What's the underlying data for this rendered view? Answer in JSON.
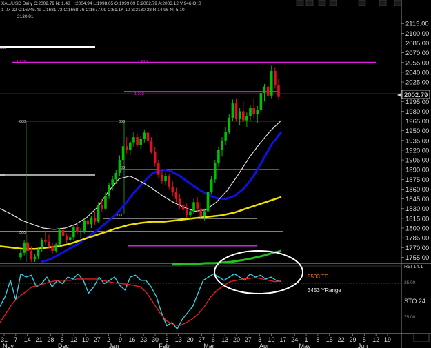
{
  "header": {
    "line1": "XAU/USD Daily C:2002.79 N: 1.48 H:2004.94 L:1998.05 O:1999.09 B:2002.79 A:2003.12 V:946 OI:0",
    "line2": "1-07-22 C:16745.49 L:1681.72 C:1668.76 C:1677.09 C:61.1K 10 S:2130.38 R:14.96 N:-5.10",
    "line3": "2130.91"
  },
  "price_axis": {
    "ticks": [
      2115,
      2100,
      2085,
      2070,
      2055,
      2040,
      2025,
      2010,
      1995,
      1980,
      1965,
      1950,
      1935,
      1920,
      1905,
      1890,
      1875,
      1860,
      1845,
      1830,
      1815,
      1800,
      1785,
      1770,
      1755
    ],
    "tick_labels": [
      "2115.00",
      "2100.00",
      "2085.00",
      "2070.00",
      "2055.00",
      "2040.00",
      "2025.00",
      "2010.00",
      "1995.00",
      "1980.00",
      "1965.00",
      "1950.00",
      "1935.00",
      "1920.00",
      "1905.00",
      "1890.00",
      "1875.00",
      "1860.00",
      "1845.00",
      "1830.00",
      "1815.00",
      "1800.00",
      "1785.00",
      "1770.00",
      "1755.00"
    ],
    "last_price_label": "2002.79"
  },
  "fib_labels": {
    "top_left": "1.272",
    "top_mid": "1.618",
    "upper": "1.272",
    "mid_left": "000",
    "mid_mid": "000",
    "half_left": "500",
    "half_mid": "500",
    "low_mid": "1.000",
    "low_left": "500",
    "far_left_top": "000",
    "far_left_mid": "000"
  },
  "osc_labels": {
    "td": "5503 TD",
    "yrange": "3453 YRange",
    "level25": "25.00",
    "level75": "75.00",
    "sto": "STO  24",
    "rsi": "RSI 14.1"
  },
  "x_axis": {
    "day_labels": [
      "31",
      "7",
      "14",
      "21",
      "28",
      "5",
      "12",
      "19",
      "27",
      "2",
      "9",
      "16",
      "23",
      "30",
      "6",
      "13",
      "20",
      "27",
      "6",
      "13",
      "20",
      "27",
      "3",
      "10",
      "17",
      "24",
      "1",
      "8",
      "15",
      "22",
      "29",
      "5",
      "12",
      "19"
    ],
    "month_labels": [
      "Nov",
      "Dec",
      "Jan",
      "Feb",
      "Mar",
      "Apr",
      "May",
      "Jun"
    ]
  },
  "colors": {
    "background": "#000000",
    "bull_candle": "#00c000",
    "bear_candle": "#e01020",
    "fib_magenta": "#e020e0",
    "ma_blue": "#1010e0",
    "ma_white": "#e0e0e0",
    "ma_yellow": "#f0e000",
    "ma_green": "#20c020",
    "osc_cyan": "#30d0e0",
    "osc_red": "#e02020",
    "ellipse": "#ffffff"
  },
  "chart_data": {
    "type": "candlestick",
    "instrument": "XAU/USD",
    "timeframe": "Daily",
    "ylim": [
      1748,
      2128
    ],
    "candles_ohlc": [
      [
        1755,
        1768,
        1750,
        1762
      ],
      [
        1762,
        1782,
        1758,
        1778
      ],
      [
        1778,
        1790,
        1760,
        1765
      ],
      [
        1765,
        1772,
        1748,
        1752
      ],
      [
        1752,
        1760,
        1748,
        1756
      ],
      [
        1756,
        1770,
        1752,
        1768
      ],
      [
        1768,
        1785,
        1764,
        1782
      ],
      [
        1782,
        1795,
        1775,
        1779
      ],
      [
        1779,
        1790,
        1768,
        1772
      ],
      [
        1772,
        1778,
        1760,
        1765
      ],
      [
        1765,
        1778,
        1762,
        1775
      ],
      [
        1775,
        1800,
        1772,
        1797
      ],
      [
        1797,
        1802,
        1785,
        1788
      ],
      [
        1788,
        1792,
        1778,
        1781
      ],
      [
        1781,
        1790,
        1772,
        1786
      ],
      [
        1786,
        1805,
        1782,
        1802
      ],
      [
        1802,
        1808,
        1790,
        1794
      ],
      [
        1794,
        1800,
        1785,
        1796
      ],
      [
        1796,
        1815,
        1792,
        1812
      ],
      [
        1812,
        1820,
        1800,
        1806
      ],
      [
        1806,
        1818,
        1800,
        1815
      ],
      [
        1815,
        1825,
        1805,
        1810
      ],
      [
        1810,
        1840,
        1808,
        1836
      ],
      [
        1836,
        1845,
        1825,
        1830
      ],
      [
        1830,
        1855,
        1828,
        1850
      ],
      [
        1850,
        1870,
        1845,
        1866
      ],
      [
        1866,
        1880,
        1858,
        1875
      ],
      [
        1875,
        1890,
        1868,
        1885
      ],
      [
        1885,
        1912,
        1880,
        1905
      ],
      [
        1905,
        1930,
        1900,
        1926
      ],
      [
        1926,
        1940,
        1915,
        1920
      ],
      [
        1920,
        1935,
        1912,
        1932
      ],
      [
        1932,
        1948,
        1925,
        1940
      ],
      [
        1940,
        1945,
        1925,
        1928
      ],
      [
        1928,
        1942,
        1922,
        1938
      ],
      [
        1938,
        1952,
        1932,
        1947
      ],
      [
        1947,
        1950,
        1930,
        1934
      ],
      [
        1934,
        1940,
        1915,
        1918
      ],
      [
        1918,
        1925,
        1895,
        1900
      ],
      [
        1900,
        1905,
        1878,
        1882
      ],
      [
        1882,
        1890,
        1868,
        1872
      ],
      [
        1872,
        1885,
        1866,
        1880
      ],
      [
        1880,
        1884,
        1860,
        1864
      ],
      [
        1864,
        1872,
        1850,
        1856
      ],
      [
        1856,
        1862,
        1840,
        1845
      ],
      [
        1845,
        1852,
        1830,
        1836
      ],
      [
        1836,
        1842,
        1822,
        1828
      ],
      [
        1828,
        1838,
        1815,
        1820
      ],
      [
        1820,
        1830,
        1812,
        1826
      ],
      [
        1826,
        1845,
        1822,
        1840
      ],
      [
        1840,
        1848,
        1825,
        1830
      ],
      [
        1830,
        1840,
        1812,
        1818
      ],
      [
        1818,
        1830,
        1812,
        1826
      ],
      [
        1826,
        1860,
        1824,
        1856
      ],
      [
        1856,
        1880,
        1852,
        1875
      ],
      [
        1875,
        1905,
        1870,
        1900
      ],
      [
        1900,
        1925,
        1895,
        1920
      ],
      [
        1920,
        1940,
        1910,
        1935
      ],
      [
        1935,
        1955,
        1928,
        1948
      ],
      [
        1948,
        1975,
        1945,
        1970
      ],
      [
        1970,
        1998,
        1965,
        1992
      ],
      [
        1992,
        2000,
        1965,
        1968
      ],
      [
        1968,
        1985,
        1958,
        1980
      ],
      [
        1980,
        1995,
        1962,
        1966
      ],
      [
        1966,
        1978,
        1955,
        1972
      ],
      [
        1972,
        1990,
        1965,
        1985
      ],
      [
        1985,
        2000,
        1968,
        1975
      ],
      [
        1975,
        1988,
        1962,
        1982
      ],
      [
        1982,
        2012,
        1978,
        2008
      ],
      [
        2008,
        2022,
        1995,
        2018
      ],
      [
        2018,
        2030,
        2000,
        2004
      ],
      [
        2004,
        2050,
        2000,
        2042
      ],
      [
        2042,
        2048,
        2015,
        2020
      ],
      [
        2020,
        2030,
        1998,
        2002
      ]
    ],
    "moving_averages": [
      {
        "color": "blue",
        "values": [
          1748,
          1752,
          1760,
          1768,
          1776,
          1786,
          1796,
          1808,
          1820,
          1836,
          1854,
          1870,
          1884,
          1890,
          1888,
          1880,
          1870,
          1860,
          1852,
          1846,
          1845,
          1850,
          1862,
          1880,
          1905,
          1930,
          1948
        ]
      },
      {
        "color": "white",
        "values": [
          1830,
          1822,
          1812,
          1806,
          1800,
          1798,
          1800,
          1806,
          1816,
          1832,
          1856,
          1876,
          1880,
          1872,
          1862,
          1850,
          1840,
          1832,
          1826,
          1828,
          1840,
          1858,
          1882,
          1908,
          1930,
          1950,
          1966
        ]
      },
      {
        "color": "yellow",
        "values": [
          1772,
          1770,
          1768,
          1768,
          1770,
          1772,
          1776,
          1782,
          1788,
          1794,
          1800,
          1805,
          1808,
          1810,
          1810,
          1812,
          1814,
          1816,
          1818,
          1820,
          1824,
          1830,
          1836,
          1842,
          1848
        ]
      },
      {
        "color": "green",
        "values": [
          1744,
          1744,
          1745,
          1745,
          1746,
          1746,
          1747,
          1748,
          1750,
          1752,
          1755,
          1758,
          1762,
          1765
        ]
      }
    ],
    "fib_levels": [
      {
        "label": "1.272",
        "price": 2055,
        "color": "magenta"
      },
      {
        "label": "1.272",
        "price": 2010,
        "color": "magenta"
      },
      {
        "label": "000",
        "price": 1965,
        "color": "white"
      },
      {
        "label": "500",
        "price": 1890,
        "color": "white"
      },
      {
        "label": "1.000",
        "price": 1815,
        "color": "white"
      },
      {
        "label": "",
        "price": 1773,
        "color": "magenta"
      }
    ],
    "oscillator": {
      "levels": [
        25,
        75
      ],
      "series": [
        {
          "name": "cyan",
          "values": [
            60,
            45,
            20,
            50,
            10,
            15,
            12,
            30,
            25,
            15,
            30,
            20,
            25,
            15,
            18,
            10,
            20,
            40,
            30,
            15,
            25,
            20,
            15,
            28,
            35,
            15,
            12,
            20,
            20,
            30,
            45,
            70,
            90,
            85,
            95,
            80,
            70,
            60,
            40,
            20,
            15,
            10,
            15,
            20,
            15,
            10,
            15,
            20,
            10,
            15,
            12,
            18,
            15,
            20,
            22
          ]
        },
        {
          "name": "red",
          "values": [
            85,
            70,
            55,
            45,
            38,
            30,
            28,
            25,
            22,
            20,
            20,
            20,
            18,
            18,
            18,
            18,
            20,
            22,
            24,
            25,
            26,
            28,
            30,
            40,
            55,
            70,
            82,
            88,
            90,
            86,
            80,
            72,
            60,
            45,
            35,
            28,
            22,
            20,
            18,
            17,
            16,
            18,
            20,
            22,
            21
          ]
        }
      ]
    }
  }
}
